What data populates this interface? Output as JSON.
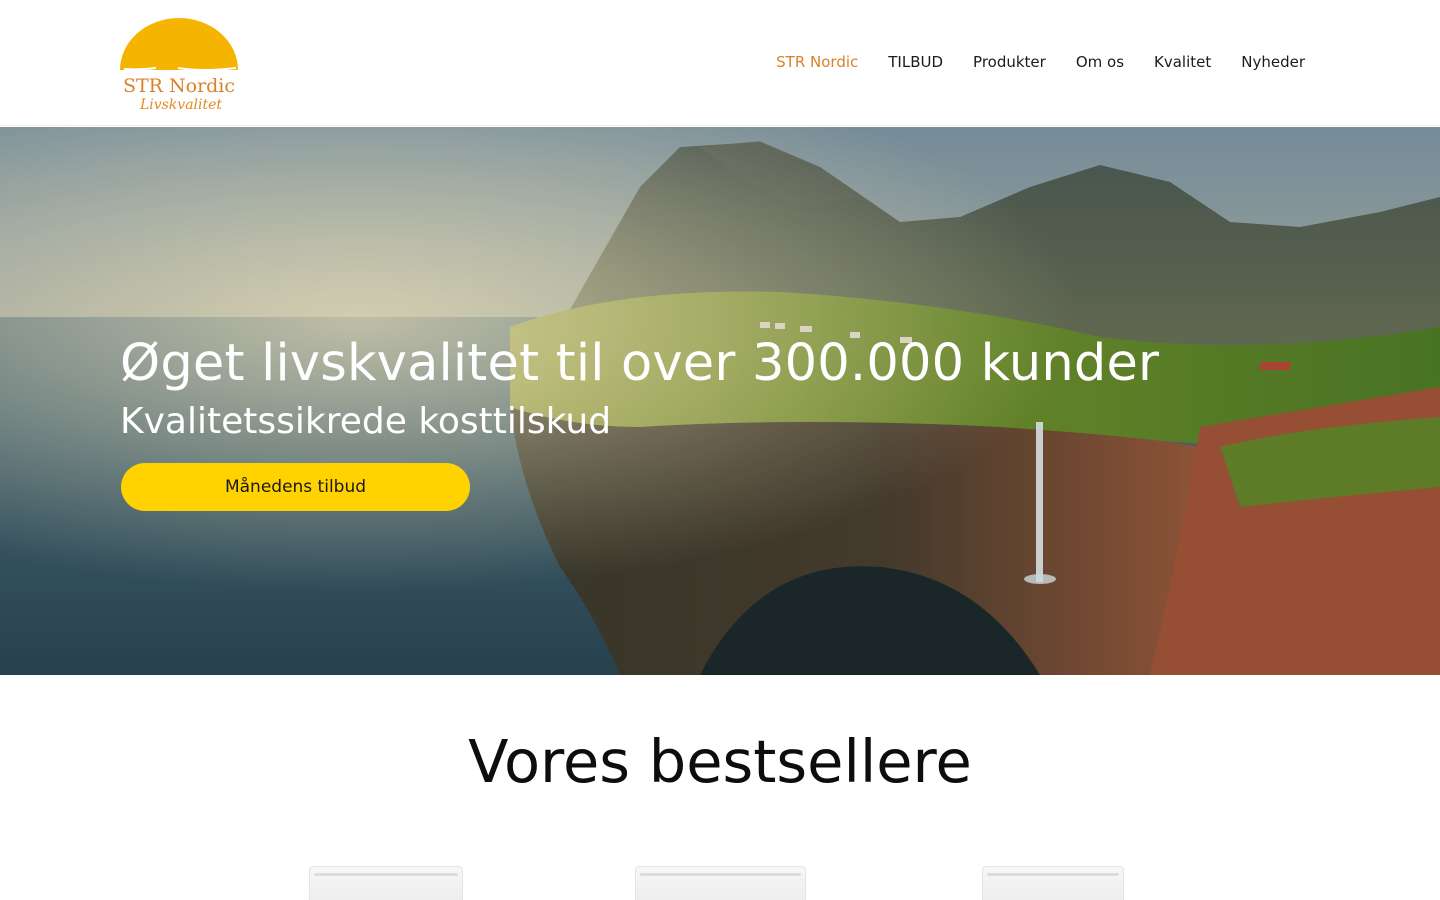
{
  "brand": {
    "name": "STR Nordic",
    "tagline": "Livskvalitet",
    "colors": {
      "sun": "#f5b400",
      "text": "#d9822b"
    }
  },
  "nav": {
    "items": [
      {
        "label": "STR Nordic",
        "active": true
      },
      {
        "label": "TILBUD",
        "active": false
      },
      {
        "label": "Produkter",
        "active": false
      },
      {
        "label": "Om os",
        "active": false
      },
      {
        "label": "Kvalitet",
        "active": false
      },
      {
        "label": "Nyheder",
        "active": false
      }
    ],
    "active_color": "#d9822b"
  },
  "hero": {
    "title": "Øget livskvalitet til over 300.000 kunder",
    "subtitle": "Kvalitetssikrede kosttilskud",
    "cta_label": "Månedens tilbud",
    "cta_color": "#ffd200"
  },
  "bestsellers": {
    "title": "Vores bestsellere",
    "product_count_visible": 3
  }
}
